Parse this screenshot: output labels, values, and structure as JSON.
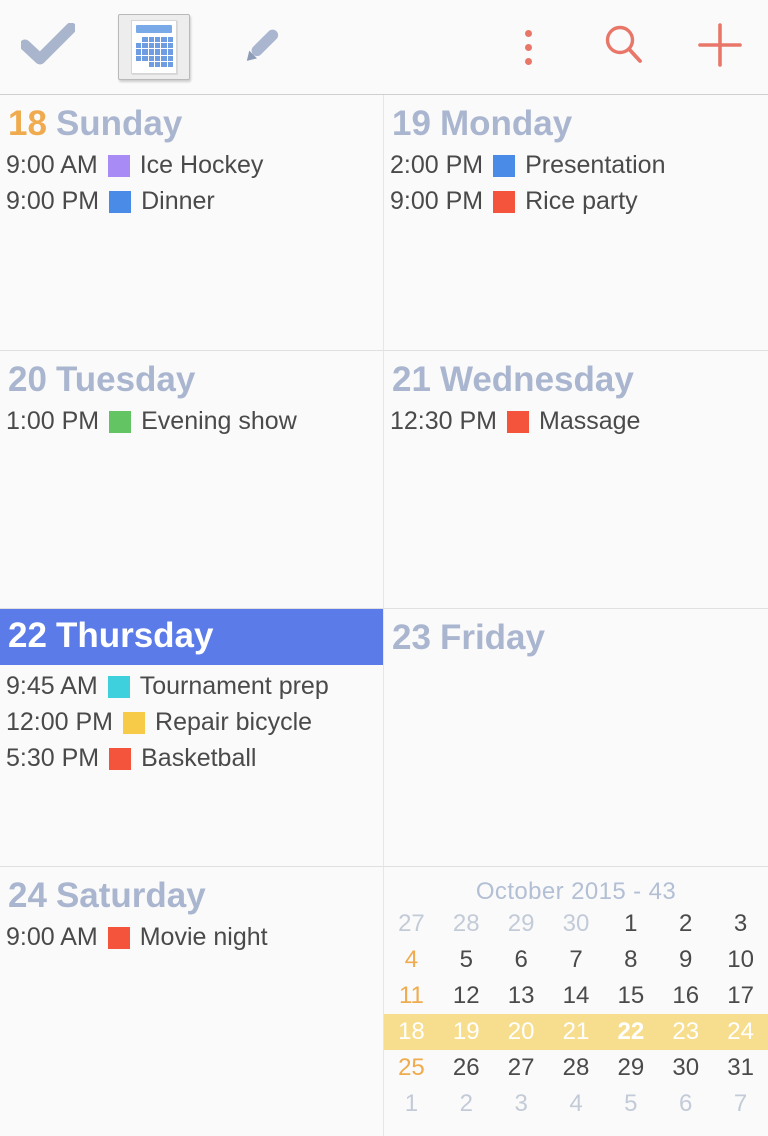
{
  "toolbar": {
    "left_items": [
      {
        "name": "tasks-check-icon",
        "icon": "check-icon",
        "label": "Tasks"
      },
      {
        "name": "calendar-view-icon",
        "icon": "calendar-icon",
        "label": "Calendar",
        "selected": true
      },
      {
        "name": "notes-pencil-icon",
        "icon": "pencil-icon",
        "label": "Notes"
      }
    ],
    "right_items": [
      {
        "name": "overflow-menu-icon",
        "icon": "three-dots-icon",
        "label": "More options"
      },
      {
        "name": "search-icon",
        "icon": "magnifier-icon",
        "label": "Search"
      },
      {
        "name": "add-event-icon",
        "icon": "plus-icon",
        "label": "Add"
      }
    ],
    "colors": {
      "accent": "#e8776a",
      "muted": "#aab6cf"
    }
  },
  "week": {
    "days": [
      {
        "num": "18",
        "name": "Sunday",
        "is_sunday": true,
        "selected": false,
        "events": [
          {
            "time": "9:00 AM",
            "title": "Ice Hockey",
            "color": "#a98bf5"
          },
          {
            "time": "9:00 PM",
            "title": "Dinner",
            "color": "#4a8be8"
          }
        ]
      },
      {
        "num": "19",
        "name": "Monday",
        "is_sunday": false,
        "selected": false,
        "events": [
          {
            "time": "2:00 PM",
            "title": "Presentation",
            "color": "#4a8be8"
          },
          {
            "time": "9:00 PM",
            "title": "Rice party",
            "color": "#f4543c"
          }
        ]
      },
      {
        "num": "20",
        "name": "Tuesday",
        "is_sunday": false,
        "selected": false,
        "events": [
          {
            "time": "1:00 PM",
            "title": "Evening show",
            "color": "#62c462"
          }
        ]
      },
      {
        "num": "21",
        "name": "Wednesday",
        "is_sunday": false,
        "selected": false,
        "events": [
          {
            "time": "12:30 PM",
            "title": "Massage",
            "color": "#f4543c"
          }
        ]
      },
      {
        "num": "22",
        "name": "Thursday",
        "is_sunday": false,
        "selected": true,
        "events": [
          {
            "time": "9:45 AM",
            "title": "Tournament prep",
            "color": "#3fd0dd"
          },
          {
            "time": "12:00 PM",
            "title": "Repair bicycle",
            "color": "#f7ca48"
          },
          {
            "time": "5:30 PM",
            "title": "Basketball",
            "color": "#f4543c"
          }
        ]
      },
      {
        "num": "23",
        "name": "Friday",
        "is_sunday": false,
        "selected": false,
        "events": []
      },
      {
        "num": "24",
        "name": "Saturday",
        "is_sunday": false,
        "selected": false,
        "events": [
          {
            "time": "9:00 AM",
            "title": "Movie night",
            "color": "#f4543c"
          }
        ]
      }
    ]
  },
  "mini_month": {
    "title": "October 2015  -  43",
    "rows": [
      {
        "highlight": false,
        "cells": [
          {
            "d": "27",
            "other": true,
            "sun": false,
            "today": false
          },
          {
            "d": "28",
            "other": true,
            "sun": false,
            "today": false
          },
          {
            "d": "29",
            "other": true,
            "sun": false,
            "today": false
          },
          {
            "d": "30",
            "other": true,
            "sun": false,
            "today": false
          },
          {
            "d": "1",
            "other": false,
            "sun": false,
            "today": false
          },
          {
            "d": "2",
            "other": false,
            "sun": false,
            "today": false
          },
          {
            "d": "3",
            "other": false,
            "sun": false,
            "today": false
          }
        ]
      },
      {
        "highlight": false,
        "cells": [
          {
            "d": "4",
            "other": false,
            "sun": true,
            "today": false
          },
          {
            "d": "5",
            "other": false,
            "sun": false,
            "today": false
          },
          {
            "d": "6",
            "other": false,
            "sun": false,
            "today": false
          },
          {
            "d": "7",
            "other": false,
            "sun": false,
            "today": false
          },
          {
            "d": "8",
            "other": false,
            "sun": false,
            "today": false
          },
          {
            "d": "9",
            "other": false,
            "sun": false,
            "today": false
          },
          {
            "d": "10",
            "other": false,
            "sun": false,
            "today": false
          }
        ]
      },
      {
        "highlight": false,
        "cells": [
          {
            "d": "11",
            "other": false,
            "sun": true,
            "today": false
          },
          {
            "d": "12",
            "other": false,
            "sun": false,
            "today": false
          },
          {
            "d": "13",
            "other": false,
            "sun": false,
            "today": false
          },
          {
            "d": "14",
            "other": false,
            "sun": false,
            "today": false
          },
          {
            "d": "15",
            "other": false,
            "sun": false,
            "today": false
          },
          {
            "d": "16",
            "other": false,
            "sun": false,
            "today": false
          },
          {
            "d": "17",
            "other": false,
            "sun": false,
            "today": false
          }
        ]
      },
      {
        "highlight": true,
        "cells": [
          {
            "d": "18",
            "other": false,
            "sun": true,
            "today": false
          },
          {
            "d": "19",
            "other": false,
            "sun": false,
            "today": false
          },
          {
            "d": "20",
            "other": false,
            "sun": false,
            "today": false
          },
          {
            "d": "21",
            "other": false,
            "sun": false,
            "today": false
          },
          {
            "d": "22",
            "other": false,
            "sun": false,
            "today": true
          },
          {
            "d": "23",
            "other": false,
            "sun": false,
            "today": false
          },
          {
            "d": "24",
            "other": false,
            "sun": false,
            "today": false
          }
        ]
      },
      {
        "highlight": false,
        "cells": [
          {
            "d": "25",
            "other": false,
            "sun": true,
            "today": false
          },
          {
            "d": "26",
            "other": false,
            "sun": false,
            "today": false
          },
          {
            "d": "27",
            "other": false,
            "sun": false,
            "today": false
          },
          {
            "d": "28",
            "other": false,
            "sun": false,
            "today": false
          },
          {
            "d": "29",
            "other": false,
            "sun": false,
            "today": false
          },
          {
            "d": "30",
            "other": false,
            "sun": false,
            "today": false
          },
          {
            "d": "31",
            "other": false,
            "sun": false,
            "today": false
          }
        ]
      },
      {
        "highlight": false,
        "cells": [
          {
            "d": "1",
            "other": true,
            "sun": false,
            "today": false
          },
          {
            "d": "2",
            "other": true,
            "sun": false,
            "today": false
          },
          {
            "d": "3",
            "other": true,
            "sun": false,
            "today": false
          },
          {
            "d": "4",
            "other": true,
            "sun": false,
            "today": false
          },
          {
            "d": "5",
            "other": true,
            "sun": false,
            "today": false
          },
          {
            "d": "6",
            "other": true,
            "sun": false,
            "today": false
          },
          {
            "d": "7",
            "other": true,
            "sun": false,
            "today": false
          }
        ]
      }
    ],
    "highlight_color": "#f7de8e",
    "sunday_color": "#efab4d"
  }
}
